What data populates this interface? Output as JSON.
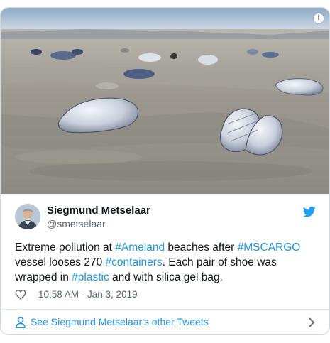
{
  "tweet": {
    "photo": {
      "icon": "info-icon",
      "alt_subject": ""
    },
    "author": {
      "name": "Siegmund Metselaar",
      "handle": "@smetselaar",
      "avatar_icon": "avatar",
      "brand_icon": "twitter-bird-icon",
      "brand_color": "#1da1f2"
    },
    "text": {
      "p1": "Extreme pollution at ",
      "tag1": "#Ameland",
      "p2": " beaches after ",
      "tag2": "#MSCARGO",
      "p3": " vessel looses 270 ",
      "tag3": "#containers",
      "p4": ". Each pair of shoe was wrapped in ",
      "tag4": "#plastic",
      "p5": " and with silica gel bag."
    },
    "meta": {
      "like_icon": "heart-icon",
      "timestamp": "10:58 AM - Jan 3, 2019"
    },
    "footer": {
      "icon": "person-icon",
      "label": "See Siegmund Metselaar's other Tweets",
      "chevron_icon": "chevron-right-icon"
    },
    "colors": {
      "link": "#1b95e0",
      "text": "#0f1419",
      "secondary": "#536471"
    }
  }
}
